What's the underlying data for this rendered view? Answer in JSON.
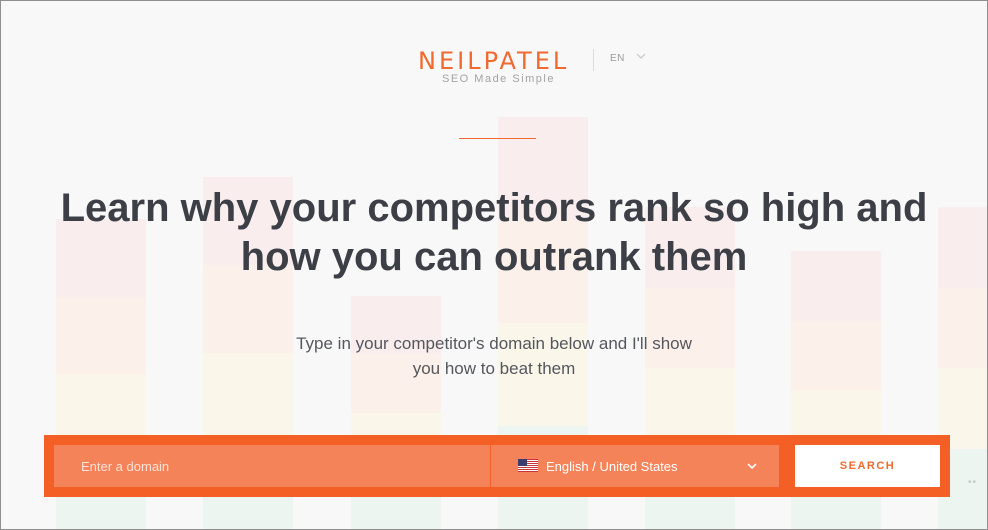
{
  "header": {
    "logo_text": "NEILPATEL",
    "tagline": "SEO Made Simple",
    "language": {
      "selected": "EN",
      "icon": "chevron-down-icon"
    }
  },
  "hero": {
    "headline_line1": "Learn why your competitors rank so high and",
    "headline_line2": "how you can outrank them",
    "subtext_line1": "Type in your competitor's domain below and I'll show",
    "subtext_line2": "you how to beat them"
  },
  "search": {
    "domain_placeholder": "Enter a domain",
    "domain_value": "",
    "locale": {
      "selected": "English / United States",
      "flag_icon": "us-flag-icon",
      "chevron_icon": "chevron-down-icon"
    },
    "button_label": "SEARCH"
  },
  "colors": {
    "brand": "#f0692f",
    "search_bar": "#f35f25",
    "input_bg": "#f5835a",
    "headline": "#3d3f47",
    "background": "#f8f8f8"
  }
}
